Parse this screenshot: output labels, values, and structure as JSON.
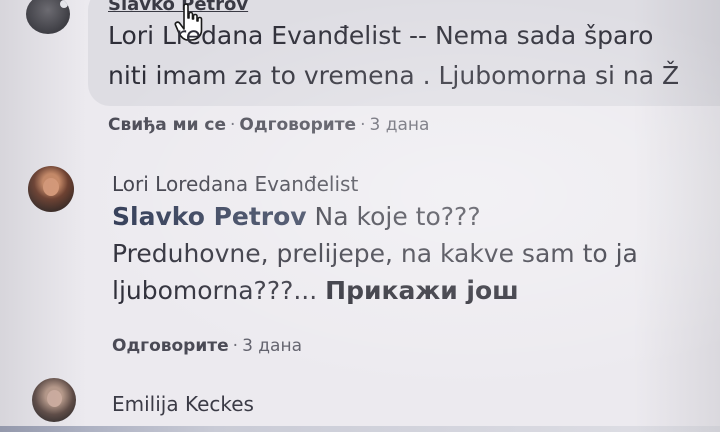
{
  "comments": [
    {
      "author": "Slavko Petrov",
      "mention": "Lori L",
      "mention_rest": "redana Evanđelist",
      "text_line1_rest": " -- Nema sada šparo",
      "text_line2": "niti imam za to vremena . Ljubomorna si na Ž",
      "actions": {
        "like": "Свиђа ми се",
        "reply": "Одговорите",
        "time": "3 дана"
      }
    },
    {
      "author": "Lori Loredana Evanđelist",
      "mention": "Slavko Petrov",
      "text_line1_rest": " Na koje to???",
      "text_line2": "Preduhovne, prelijepe, na kakve sam to ja",
      "text_line3": "ljubomorna???... ",
      "see_more": "Прикажи још",
      "actions": {
        "reply": "Одговорите",
        "time": "3 дана"
      }
    },
    {
      "author": "Emilija Keckes"
    }
  ],
  "separator": "·",
  "icons": {
    "cursor": "hand-pointer-icon"
  }
}
